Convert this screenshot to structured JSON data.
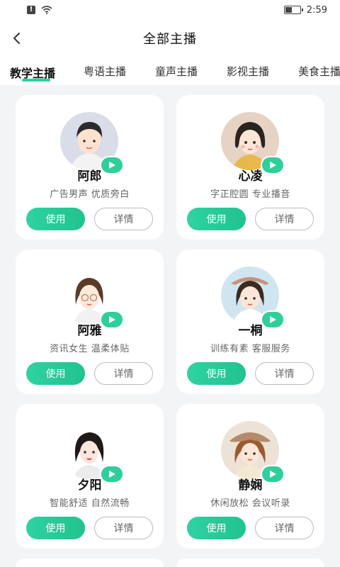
{
  "status_bar": {
    "time": "2:59"
  },
  "header": {
    "title": "全部主播"
  },
  "tabs": [
    {
      "label": "教学主播",
      "active": true
    },
    {
      "label": "粤语主播",
      "active": false
    },
    {
      "label": "童声主播",
      "active": false
    },
    {
      "label": "影视主播",
      "active": false
    },
    {
      "label": "美食主播",
      "active": false
    }
  ],
  "colors": {
    "accent": "#2ecf9a",
    "background": "#f3f4f6"
  },
  "anchors": [
    {
      "name": "阿郎",
      "desc": "广告男声 优质旁白",
      "use_label": "使用",
      "detail_label": "详情"
    },
    {
      "name": "心凌",
      "desc": "字正腔圆 专业播音",
      "use_label": "使用",
      "detail_label": "详情"
    },
    {
      "name": "阿雅",
      "desc": "资讯女生 温柔体贴",
      "use_label": "使用",
      "detail_label": "详情"
    },
    {
      "name": "一桐",
      "desc": "训练有素 客服服务",
      "use_label": "使用",
      "detail_label": "详情"
    },
    {
      "name": "夕阳",
      "desc": "智能舒适 自然流畅",
      "use_label": "使用",
      "detail_label": "详情"
    },
    {
      "name": "静娴",
      "desc": "休闲放松 会议听录",
      "use_label": "使用",
      "detail_label": "详情"
    }
  ]
}
